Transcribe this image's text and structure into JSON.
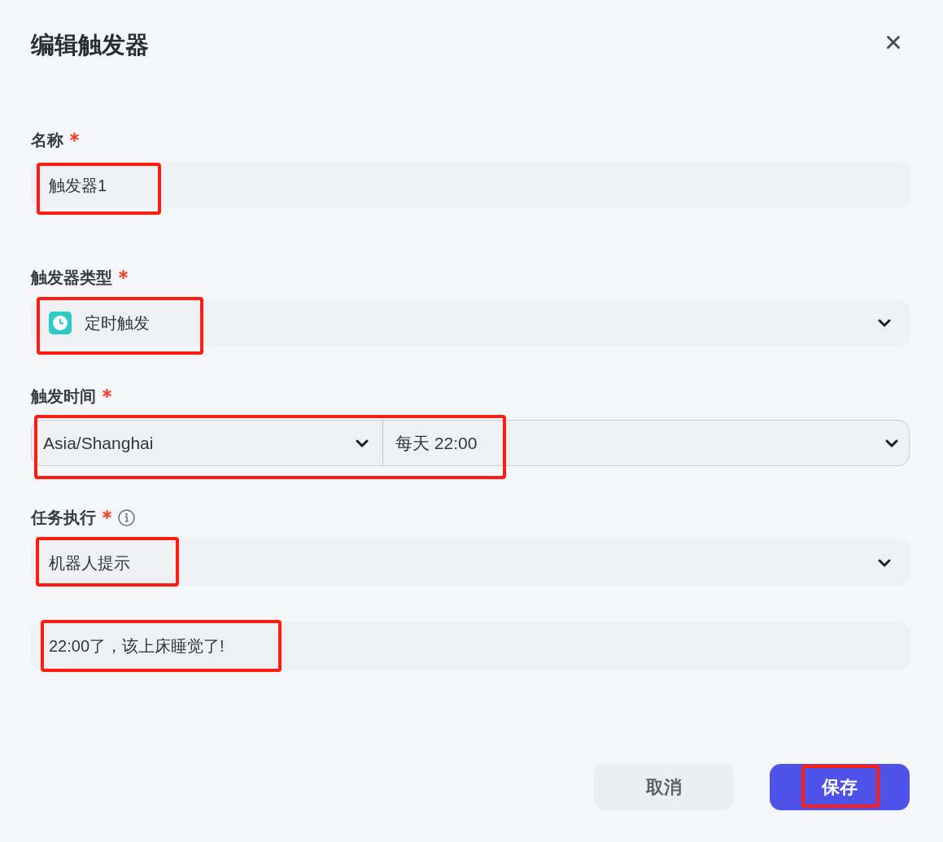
{
  "dialog": {
    "title": "编辑触发器"
  },
  "fields": [
    {
      "kind": "text",
      "label": "名称",
      "required": true,
      "value": "触发器1",
      "highlighted": true
    },
    {
      "kind": "type_select",
      "label": "触发器类型",
      "required": true,
      "value": "定时触发",
      "highlighted": true
    },
    {
      "kind": "schedule",
      "label": "触发时间",
      "required": true,
      "timezone": "Asia/Shanghai",
      "schedule": "每天 22:00",
      "highlighted": true
    },
    {
      "kind": "select",
      "label": "任务执行",
      "required": true,
      "info_hint": true,
      "value": "机器人提示",
      "highlighted": true
    },
    {
      "kind": "textarea",
      "value": "22:00了，该上床睡觉了!",
      "highlighted": true
    }
  ],
  "buttons": [
    {
      "kind": "secondary",
      "label": "取消",
      "highlighted": false
    },
    {
      "kind": "primary",
      "label": "保存",
      "highlighted": true
    }
  ]
}
